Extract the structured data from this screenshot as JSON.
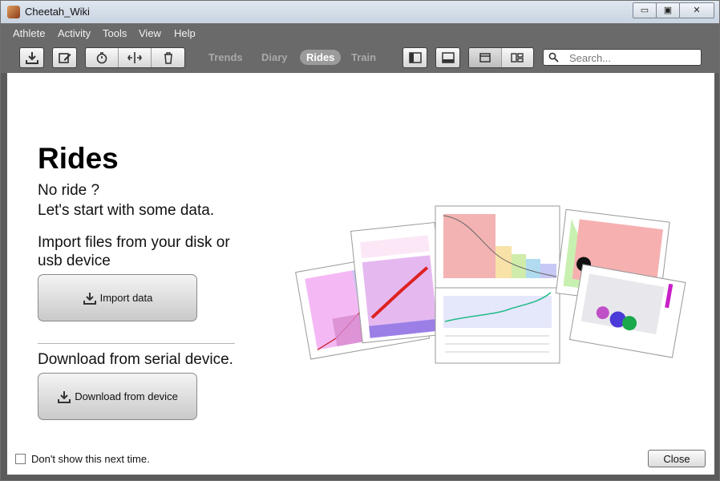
{
  "window": {
    "title": "Cheetah_Wiki",
    "minimize": "▭",
    "maximize": "▣",
    "close": "✕"
  },
  "menu": [
    "Athlete",
    "Activity",
    "Tools",
    "View",
    "Help"
  ],
  "toolbar": {
    "views": [
      "Trends",
      "Diary",
      "Rides",
      "Train"
    ],
    "active_view": "Rides",
    "search_placeholder": "Search..."
  },
  "main": {
    "title": "Rides",
    "no_ride_line1": "No ride ?",
    "no_ride_line2": "Let's start with some data.",
    "import_text_line1": "Import files from your disk or",
    "import_text_line2": "usb device",
    "import_button": "Import data",
    "download_text": "Download from serial device.",
    "download_button": "Download from device"
  },
  "footer": {
    "dont_show": "Don't show this next time.",
    "close_button": "Close"
  },
  "colors": {
    "chrome": "#6a6a6a",
    "accent_inactive_tab": "#a9a9a9"
  },
  "icons": [
    "download-icon",
    "edit-icon",
    "stopwatch-icon",
    "split-icon",
    "trash-icon",
    "sidebar-left-icon",
    "bottom-panel-icon",
    "tabbed-view-icon",
    "tiled-view-icon",
    "search-icon"
  ]
}
